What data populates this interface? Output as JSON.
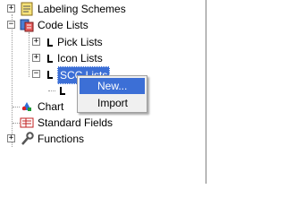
{
  "tree": {
    "items": [
      {
        "label": "Labeling Schemes",
        "expander": "+",
        "icon": "labeling-schemes-icon"
      },
      {
        "label": "Code Lists",
        "expander": "−",
        "icon": "code-lists-icon"
      },
      {
        "label": "Pick Lists",
        "expander": "+",
        "icon": "list-icon"
      },
      {
        "label": "Icon Lists",
        "expander": "+",
        "icon": "list-icon"
      },
      {
        "label": "SCC Lists",
        "expander": "−",
        "icon": "list-icon"
      },
      {
        "label": "Chart",
        "icon": "chart-icon"
      },
      {
        "label": "Standard Fields",
        "icon": "standard-fields-icon"
      },
      {
        "label": "Functions",
        "expander": "+",
        "icon": "wrench-icon"
      }
    ]
  },
  "context_menu": {
    "items": [
      {
        "label": "New..."
      },
      {
        "label": "Import"
      }
    ]
  },
  "colors": {
    "selection": "#3c6fd6",
    "menu_bg": "#f0f0f0"
  }
}
